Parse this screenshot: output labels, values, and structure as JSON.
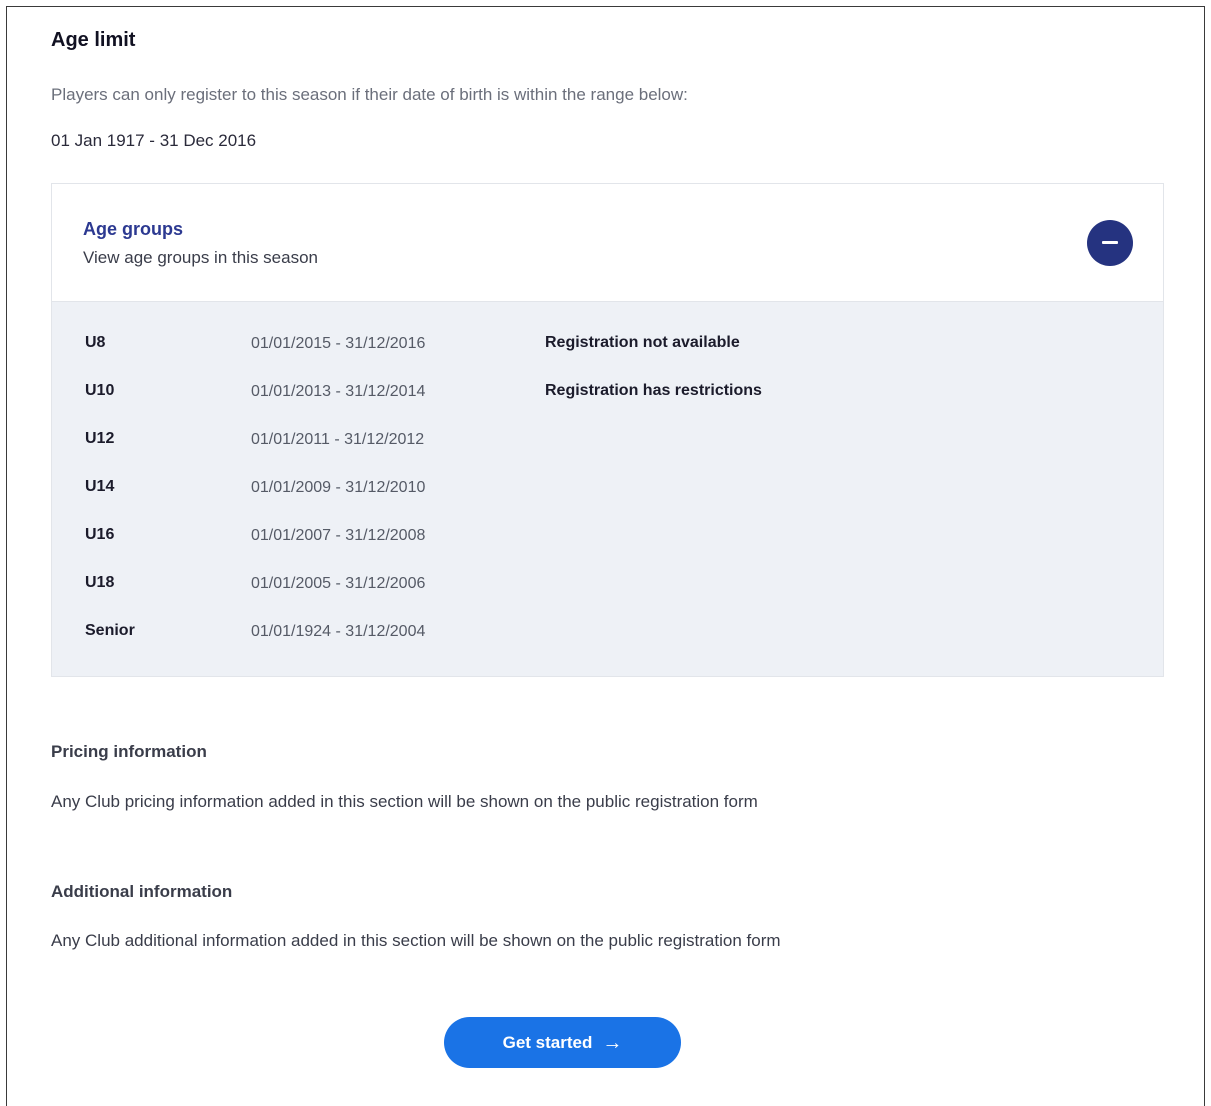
{
  "age_limit": {
    "title": "Age limit",
    "description": "Players can only register to this season if their date of birth is within the range below:",
    "range": "01 Jan 1917 - 31 Dec 2016"
  },
  "age_groups": {
    "title": "Age groups",
    "subtitle": "View age groups in this season",
    "collapse_icon": "minus-circle-icon",
    "rows": [
      {
        "name": "U8",
        "range": "01/01/2015 - 31/12/2016",
        "status": "Registration not available"
      },
      {
        "name": "U10",
        "range": "01/01/2013 - 31/12/2014",
        "status": "Registration has restrictions"
      },
      {
        "name": "U12",
        "range": "01/01/2011 - 31/12/2012",
        "status": ""
      },
      {
        "name": "U14",
        "range": "01/01/2009 - 31/12/2010",
        "status": ""
      },
      {
        "name": "U16",
        "range": "01/01/2007 - 31/12/2008",
        "status": ""
      },
      {
        "name": "U18",
        "range": "01/01/2005 - 31/12/2006",
        "status": ""
      },
      {
        "name": "Senior",
        "range": "01/01/1924 - 31/12/2004",
        "status": ""
      }
    ]
  },
  "pricing": {
    "heading": "Pricing information",
    "text": "Any Club pricing information added in this section will be shown on the public registration form"
  },
  "additional": {
    "heading": "Additional information",
    "text": "Any Club additional information added in this section will be shown on the public registration form"
  },
  "cta": {
    "label": "Get started",
    "arrow": "→",
    "icon": "arrow-right-icon"
  },
  "colors": {
    "accent_blue": "#1a73e6",
    "navy": "#253380",
    "panel_bg": "#eef1f6"
  }
}
